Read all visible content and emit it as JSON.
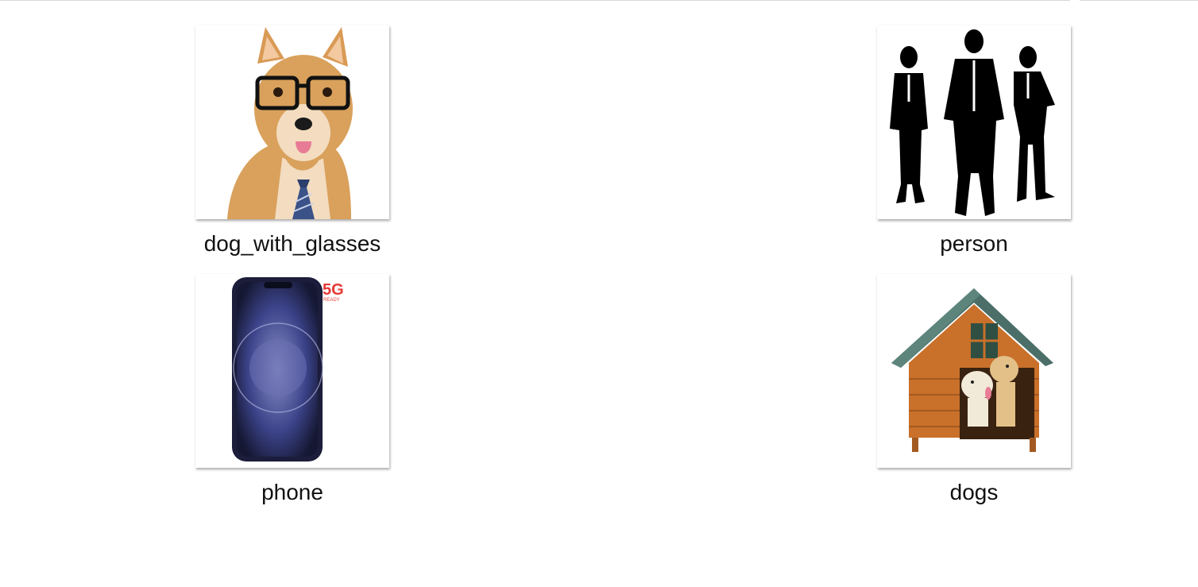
{
  "files": [
    {
      "name": "dog_with_glasses",
      "thumbnail": "dog-with-glasses-image"
    },
    {
      "name": "person",
      "thumbnail": "business-people-silhouette-image"
    },
    {
      "name": "phone",
      "thumbnail": "smartphone-image",
      "badge": "5G",
      "badge_sub": "READY"
    },
    {
      "name": "dogs",
      "thumbnail": "doghouse-with-dogs-image"
    }
  ],
  "colors": {
    "badge_red": "#e53935",
    "phone_body": "#1b1d3a",
    "doghouse_wood": "#c9702a",
    "doghouse_roof": "#4b6f68",
    "dog_fur": "#d9a15c"
  }
}
